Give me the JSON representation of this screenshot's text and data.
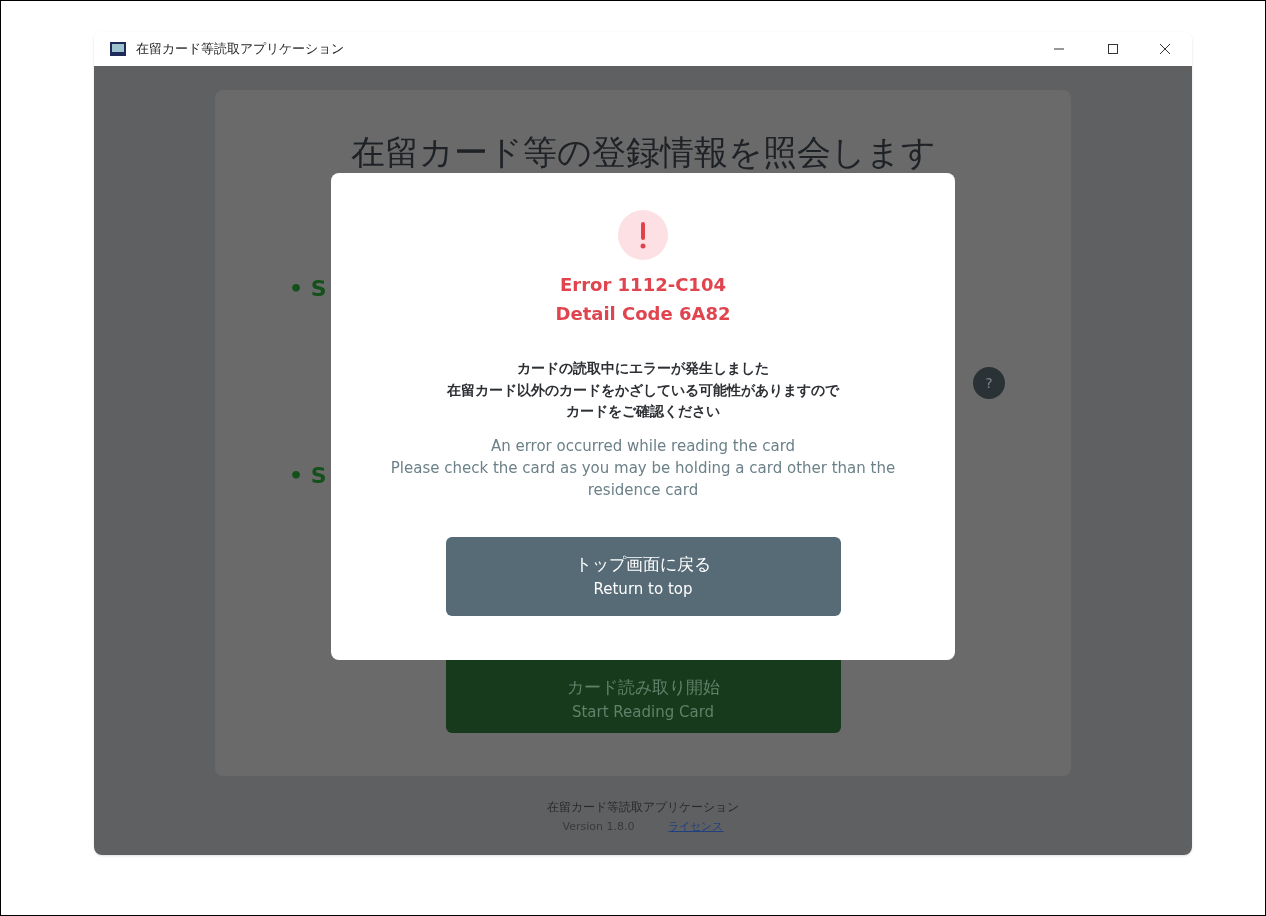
{
  "window": {
    "title": "在留カード等読取アプリケーション"
  },
  "main": {
    "heading": "在留カード等の登録情報を照会します",
    "bullets": [
      {
        "text": "• S"
      },
      {
        "text": "• S"
      }
    ],
    "help_button": {
      "label": "?"
    },
    "start_button": {
      "label_ja": "カード読み取り開始",
      "label_en": "Start Reading Card"
    }
  },
  "footer": {
    "app_name": "在留カード等読取アプリケーション",
    "version": "Version 1.8.0",
    "license_link": "ライセンス"
  },
  "dialog": {
    "error_code": "Error 1112-C104",
    "detail_code": "Detail Code 6A82",
    "message_ja": [
      "カードの読取中にエラーが発生しました",
      "在留カード以外のカードをかざしている可能性がありますので",
      "カードをご確認ください"
    ],
    "message_en": [
      "An error occurred while reading the card",
      "Please check the card as you may be holding a card other than the",
      "residence card"
    ],
    "button": {
      "label_ja": "トップ画面に戻る",
      "label_en": "Return to top"
    }
  }
}
